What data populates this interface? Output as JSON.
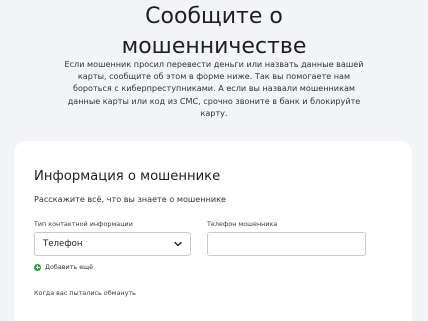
{
  "hero": {
    "title_line1": "Сообщите о",
    "title_line2": "мошенничестве",
    "description": "Если мошенник просил перевести деньги или назвать данные вашей карты, сообщите об этом в форме ниже. Так вы помогаете нам бороться с киберпреступниками. А если вы назвали мошенникам данные карты или код из СМС, срочно звоните в банк и блокируйте карту."
  },
  "form": {
    "title": "Информация о мошеннике",
    "subtitle": "Расскажите всё, что вы знаете о мошеннике",
    "contact_type": {
      "label": "Тип контактной информации",
      "value": "Телефон",
      "icon": "chevron-down-icon"
    },
    "phone": {
      "label": "Телефон мошенника",
      "value": "",
      "placeholder": ""
    },
    "add_more": {
      "label": "Добавить ещё",
      "icon": "plus-circle-icon",
      "color": "#1d9f3e"
    },
    "when_label": "Когда вас пытались обмануть"
  }
}
